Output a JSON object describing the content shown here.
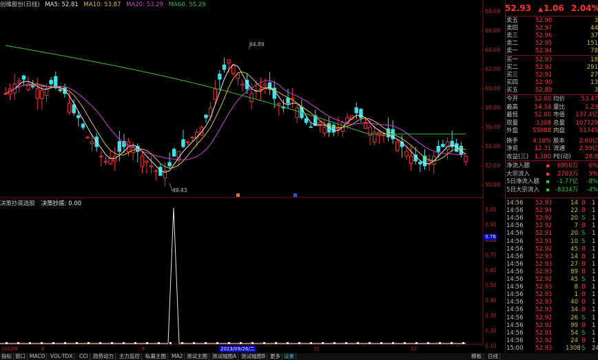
{
  "header": {
    "stock_name": "创维股份(日线)",
    "ma5": "MA5: 52.81",
    "ma10": "MA10: 53.87",
    "ma20": "MA20: 53.29",
    "ma60": "MA60: 55.29"
  },
  "indicator_header": {
    "name": "决策抄底选股",
    "value": "决策抄底: 0.00"
  },
  "price_axis": [
    "68.00",
    "66.00",
    "64.00",
    "62.00",
    "60.00",
    "58.00",
    "56.00",
    "54.00",
    "52.00",
    "50.00"
  ],
  "indicator_axis": [
    "1.00",
    "0.90",
    "0.80",
    "0.70",
    "0.60",
    "0.50",
    "0.40",
    "0.30",
    "0.20",
    "0.10"
  ],
  "cursor_value": "0.76",
  "annotations": {
    "high": "64.89",
    "low": "49.43"
  },
  "dates": {
    "left": "2023年",
    "m1": "8",
    "m2": "9",
    "highlight": "2023/09/26/二",
    "m3": "11",
    "m4": "12"
  },
  "colors": {
    "up": "#ff3030",
    "down": "#40e0e8",
    "ma5": "#e8e8e8",
    "ma10": "#e0c020",
    "ma20": "#d040d0",
    "ma60": "#30c030"
  },
  "quote": {
    "price": "52.93",
    "change": "1.06",
    "pct": "2.04%",
    "change_icon": "up-arrow-icon"
  },
  "orderbook": [
    {
      "label": "卖五",
      "price": "52.98",
      "vol": "3"
    },
    {
      "label": "卖四",
      "price": "52.97",
      "vol": "44"
    },
    {
      "label": "卖三",
      "price": "52.96",
      "vol": "37"
    },
    {
      "label": "卖二",
      "price": "52.95",
      "vol": "151"
    },
    {
      "label": "卖一",
      "price": "52.94",
      "vol": "78"
    },
    {
      "label": "买一",
      "price": "52.93",
      "vol": "18"
    },
    {
      "label": "买二",
      "price": "52.92",
      "vol": "291"
    },
    {
      "label": "买三",
      "price": "52.91",
      "vol": "27"
    },
    {
      "label": "买四",
      "price": "52.90",
      "vol": "13"
    },
    {
      "label": "买五",
      "price": "52.89",
      "vol": "3"
    }
  ],
  "stats": [
    {
      "l1": "今开",
      "v1": "52.00",
      "l2": "均价",
      "v2": "53.47"
    },
    {
      "l1": "最高",
      "v1": "54.34",
      "l2": "量比",
      "v2": "1.23"
    },
    {
      "l1": "最低",
      "v1": "52.00",
      "l2": "市值",
      "v2": "137.4亿"
    },
    {
      "l1": "现量",
      "v1": "1308",
      "l2": "总量",
      "v2": "107729"
    },
    {
      "l1": "外盘",
      "v1": "55988",
      "l2": "内盘",
      "v2": "51745"
    },
    {
      "l1": "换手",
      "v1": "4.16%",
      "l2": "股本",
      "v2": "2.60亿"
    },
    {
      "l1": "净资",
      "v1": "12.31",
      "l2": "流通",
      "v2": "2.59亿"
    },
    {
      "l1": "收益(三)",
      "v1": "1.380",
      "l2": "PE(动)",
      "v2": "28.8"
    }
  ],
  "capital_flow": [
    {
      "label": "净流入额",
      "val": "6950万",
      "pct": "6%",
      "color": "#ff3030"
    },
    {
      "label": "大宗流入",
      "val": "2703万",
      "pct": "5%",
      "color": "#ff3030"
    },
    {
      "label": "5日净流入额",
      "val": "-1.77亿",
      "pct": "-8%",
      "color": "#30c030"
    },
    {
      "label": "5日大宗流入",
      "val": "-8334万",
      "pct": "-4%",
      "color": "#30c030"
    }
  ],
  "ticks": [
    {
      "t": "14:56",
      "p": "52.93",
      "v": "14",
      "s": "B",
      "n": "1"
    },
    {
      "t": "14:56",
      "p": "52.94",
      "v": "22",
      "s": "B",
      "n": "1"
    },
    {
      "t": "14:56",
      "p": "52.92",
      "v": "20",
      "s": "S",
      "n": "1"
    },
    {
      "t": "14:56",
      "p": "52.92",
      "v": "7",
      "s": "B",
      "n": "1"
    },
    {
      "t": "14:56",
      "p": "52.91",
      "v": "20",
      "s": "S",
      "n": "1"
    },
    {
      "t": "14:56",
      "p": "52.91",
      "v": "10",
      "s": "S",
      "n": "1"
    },
    {
      "t": "14:56",
      "p": "52.92",
      "v": "45",
      "s": "B",
      "n": "1"
    },
    {
      "t": "14:56",
      "p": "52.93",
      "v": "14",
      "s": "B",
      "n": "1"
    },
    {
      "t": "14:56",
      "p": "52.93",
      "v": "27",
      "s": "B",
      "n": "1"
    },
    {
      "t": "14:56",
      "p": "52.93",
      "v": "89",
      "s": "B",
      "n": "1"
    },
    {
      "t": "14:56",
      "p": "52.92",
      "v": "45",
      "s": "S",
      "n": "1"
    },
    {
      "t": "14:56",
      "p": "52.93",
      "v": "8",
      "s": "B",
      "n": "1"
    },
    {
      "t": "14:56",
      "p": "52.93",
      "v": "1",
      "s": "B",
      "n": "1"
    },
    {
      "t": "14:56",
      "p": "52.93",
      "v": "40",
      "s": "B",
      "n": "1"
    },
    {
      "t": "14:56",
      "p": "52.93",
      "v": "34",
      "s": "B",
      "n": "1"
    },
    {
      "t": "14:56",
      "p": "52.92",
      "v": "26",
      "s": "S",
      "n": "1"
    },
    {
      "t": "14:56",
      "p": "52.92",
      "v": "99",
      "s": "B",
      "n": "1"
    },
    {
      "t": "14:56",
      "p": "52.91",
      "v": "54",
      "s": "S",
      "n": "1"
    },
    {
      "t": "14:56",
      "p": "52.92",
      "v": "24",
      "s": "B",
      "n": "1"
    },
    {
      "t": "15:00",
      "p": "52.93",
      "v": "1308",
      "s": "S",
      "n": "24"
    }
  ],
  "bottom_tabs": [
    "指标",
    "窗口",
    "MACD",
    "VOL-TDX",
    "CCI",
    "趋势动力",
    "主力监控",
    "私募主图",
    "MA2",
    "测试主图",
    "测试幅图A",
    "测试幅图B",
    "更多",
    "设置"
  ],
  "bottom_right": [
    "模板",
    "日线"
  ]
}
